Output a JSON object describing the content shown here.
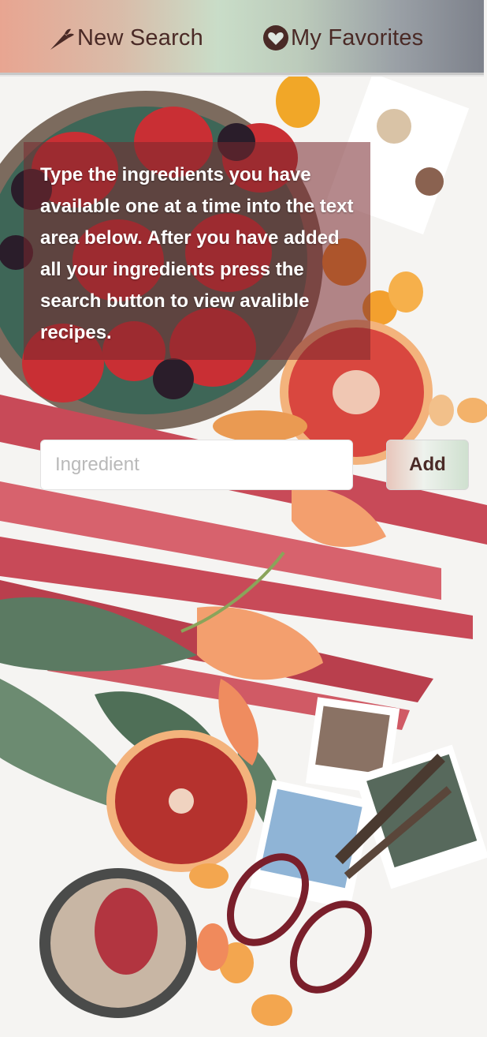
{
  "nav": {
    "new_search": {
      "label": "New Search",
      "icon": "carrot-icon"
    },
    "favorites": {
      "label": "My Favorites",
      "icon": "heart-circle-icon"
    }
  },
  "instructions": {
    "text": "Type the ingredients you have available one at a time into the text area below. After you have added all your ingredients press the search button to view avalible recipes."
  },
  "search": {
    "placeholder": "Ingredient",
    "value": "",
    "add_label": "Add"
  },
  "colors": {
    "nav_text": "#4a2a26",
    "instructions_bg": "rgba(120,40,45,0.55)"
  }
}
